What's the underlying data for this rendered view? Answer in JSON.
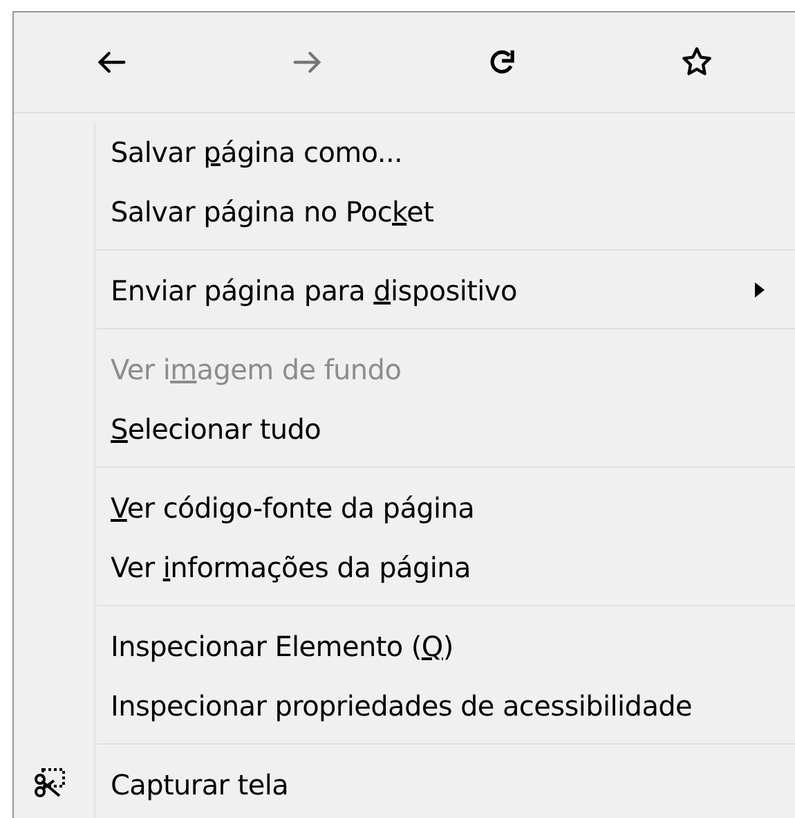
{
  "toolbar": [
    {
      "kind": "back",
      "disabled": false
    },
    {
      "kind": "forward",
      "disabled": true
    },
    {
      "kind": "reload",
      "disabled": false
    },
    {
      "kind": "bookmark",
      "disabled": false
    }
  ],
  "groups": [
    {
      "items": [
        {
          "kind": "plain",
          "label": {
            "pre": "Salvar ",
            "key": "p",
            "post": "ágina como..."
          },
          "disabled": false
        },
        {
          "kind": "plain",
          "label": {
            "pre": "Salvar página no Poc",
            "key": "k",
            "post": "et"
          },
          "disabled": false
        }
      ]
    },
    {
      "items": [
        {
          "kind": "submenu",
          "label": {
            "pre": "Enviar página para ",
            "key": "d",
            "post": "ispositivo"
          },
          "disabled": false
        }
      ]
    },
    {
      "items": [
        {
          "kind": "plain",
          "label": {
            "pre": "Ver i",
            "key": "m",
            "post": "agem de fundo"
          },
          "disabled": true
        },
        {
          "kind": "plain",
          "label": {
            "key": "S",
            "post": "elecionar tudo"
          },
          "disabled": false
        }
      ]
    },
    {
      "items": [
        {
          "kind": "plain",
          "label": {
            "key": "V",
            "post": "er código-fonte da página"
          },
          "disabled": false
        },
        {
          "kind": "plain",
          "label": {
            "pre": "Ver ",
            "key": "i",
            "post": "nformações da página"
          },
          "disabled": false
        }
      ]
    },
    {
      "items": [
        {
          "kind": "plain",
          "label": {
            "pre": "Inspecionar Elemento (",
            "key": "Q",
            "post": ")"
          },
          "disabled": false
        },
        {
          "kind": "plain",
          "label": {
            "pre": "Inspecionar propriedades de acessibilidade"
          },
          "disabled": false
        }
      ]
    },
    {
      "items": [
        {
          "kind": "screenshot",
          "label": {
            "pre": "Capturar tela"
          },
          "disabled": false
        }
      ]
    }
  ]
}
